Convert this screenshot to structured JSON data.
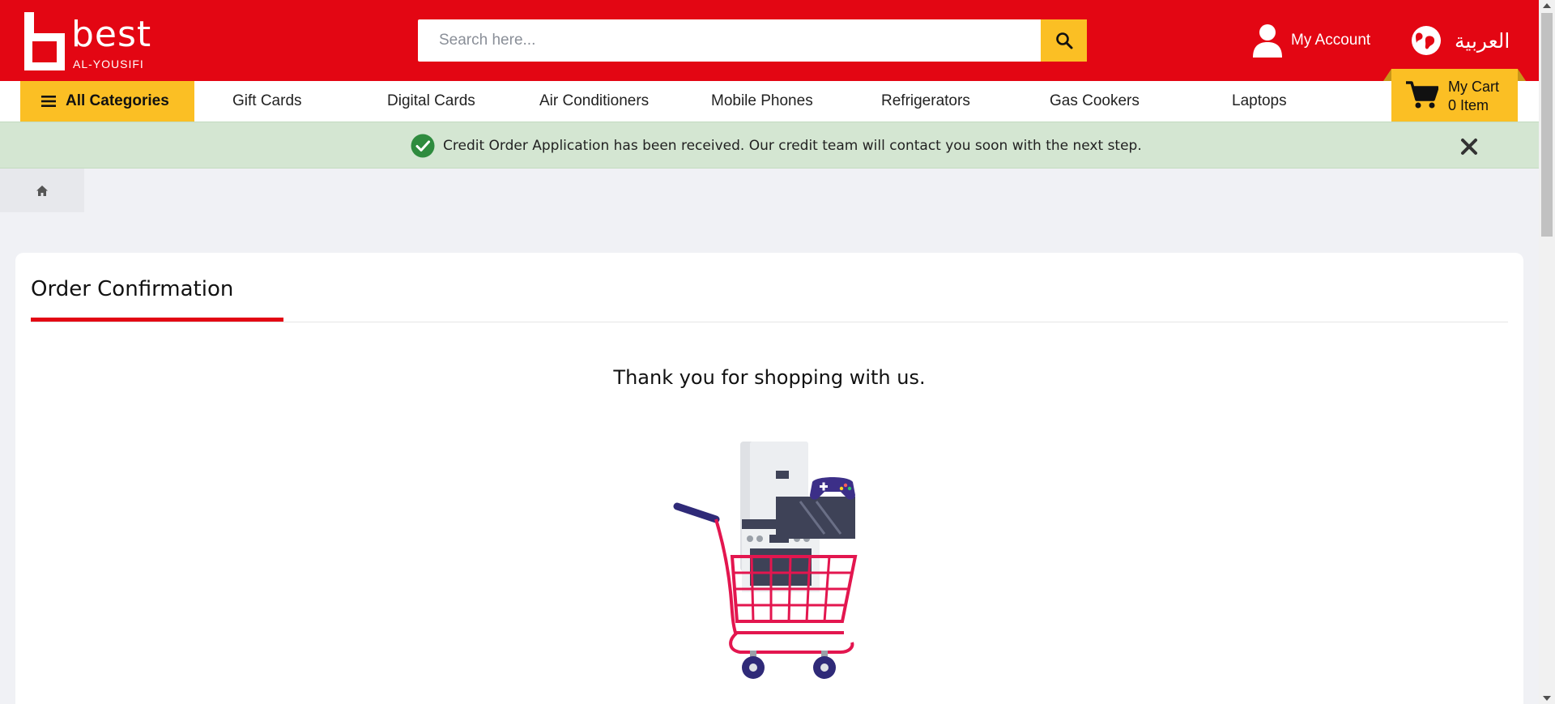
{
  "header": {
    "logo_word": "best",
    "logo_sub": "AL-YOUSIFI",
    "search_placeholder": "Search here...",
    "account_label": "My Account",
    "lang_label": "العربية"
  },
  "nav": {
    "all_categories": "All Categories",
    "items": [
      "Gift Cards",
      "Digital Cards",
      "Air Conditioners",
      "Mobile Phones",
      "Refrigerators",
      "Gas Cookers",
      "Laptops"
    ],
    "cart_label": "My Cart",
    "cart_count": "0 Item"
  },
  "alert": {
    "message": "Credit Order Application has been received. Our credit team will contact you soon with the next step."
  },
  "card": {
    "title": "Order Confirmation",
    "thanks": "Thank you for shopping with us."
  },
  "colors": {
    "brand_red": "#e30613",
    "accent_yellow": "#fbbf24",
    "success_bg": "#d4e6d2",
    "success_icon": "#2e8b3e"
  }
}
